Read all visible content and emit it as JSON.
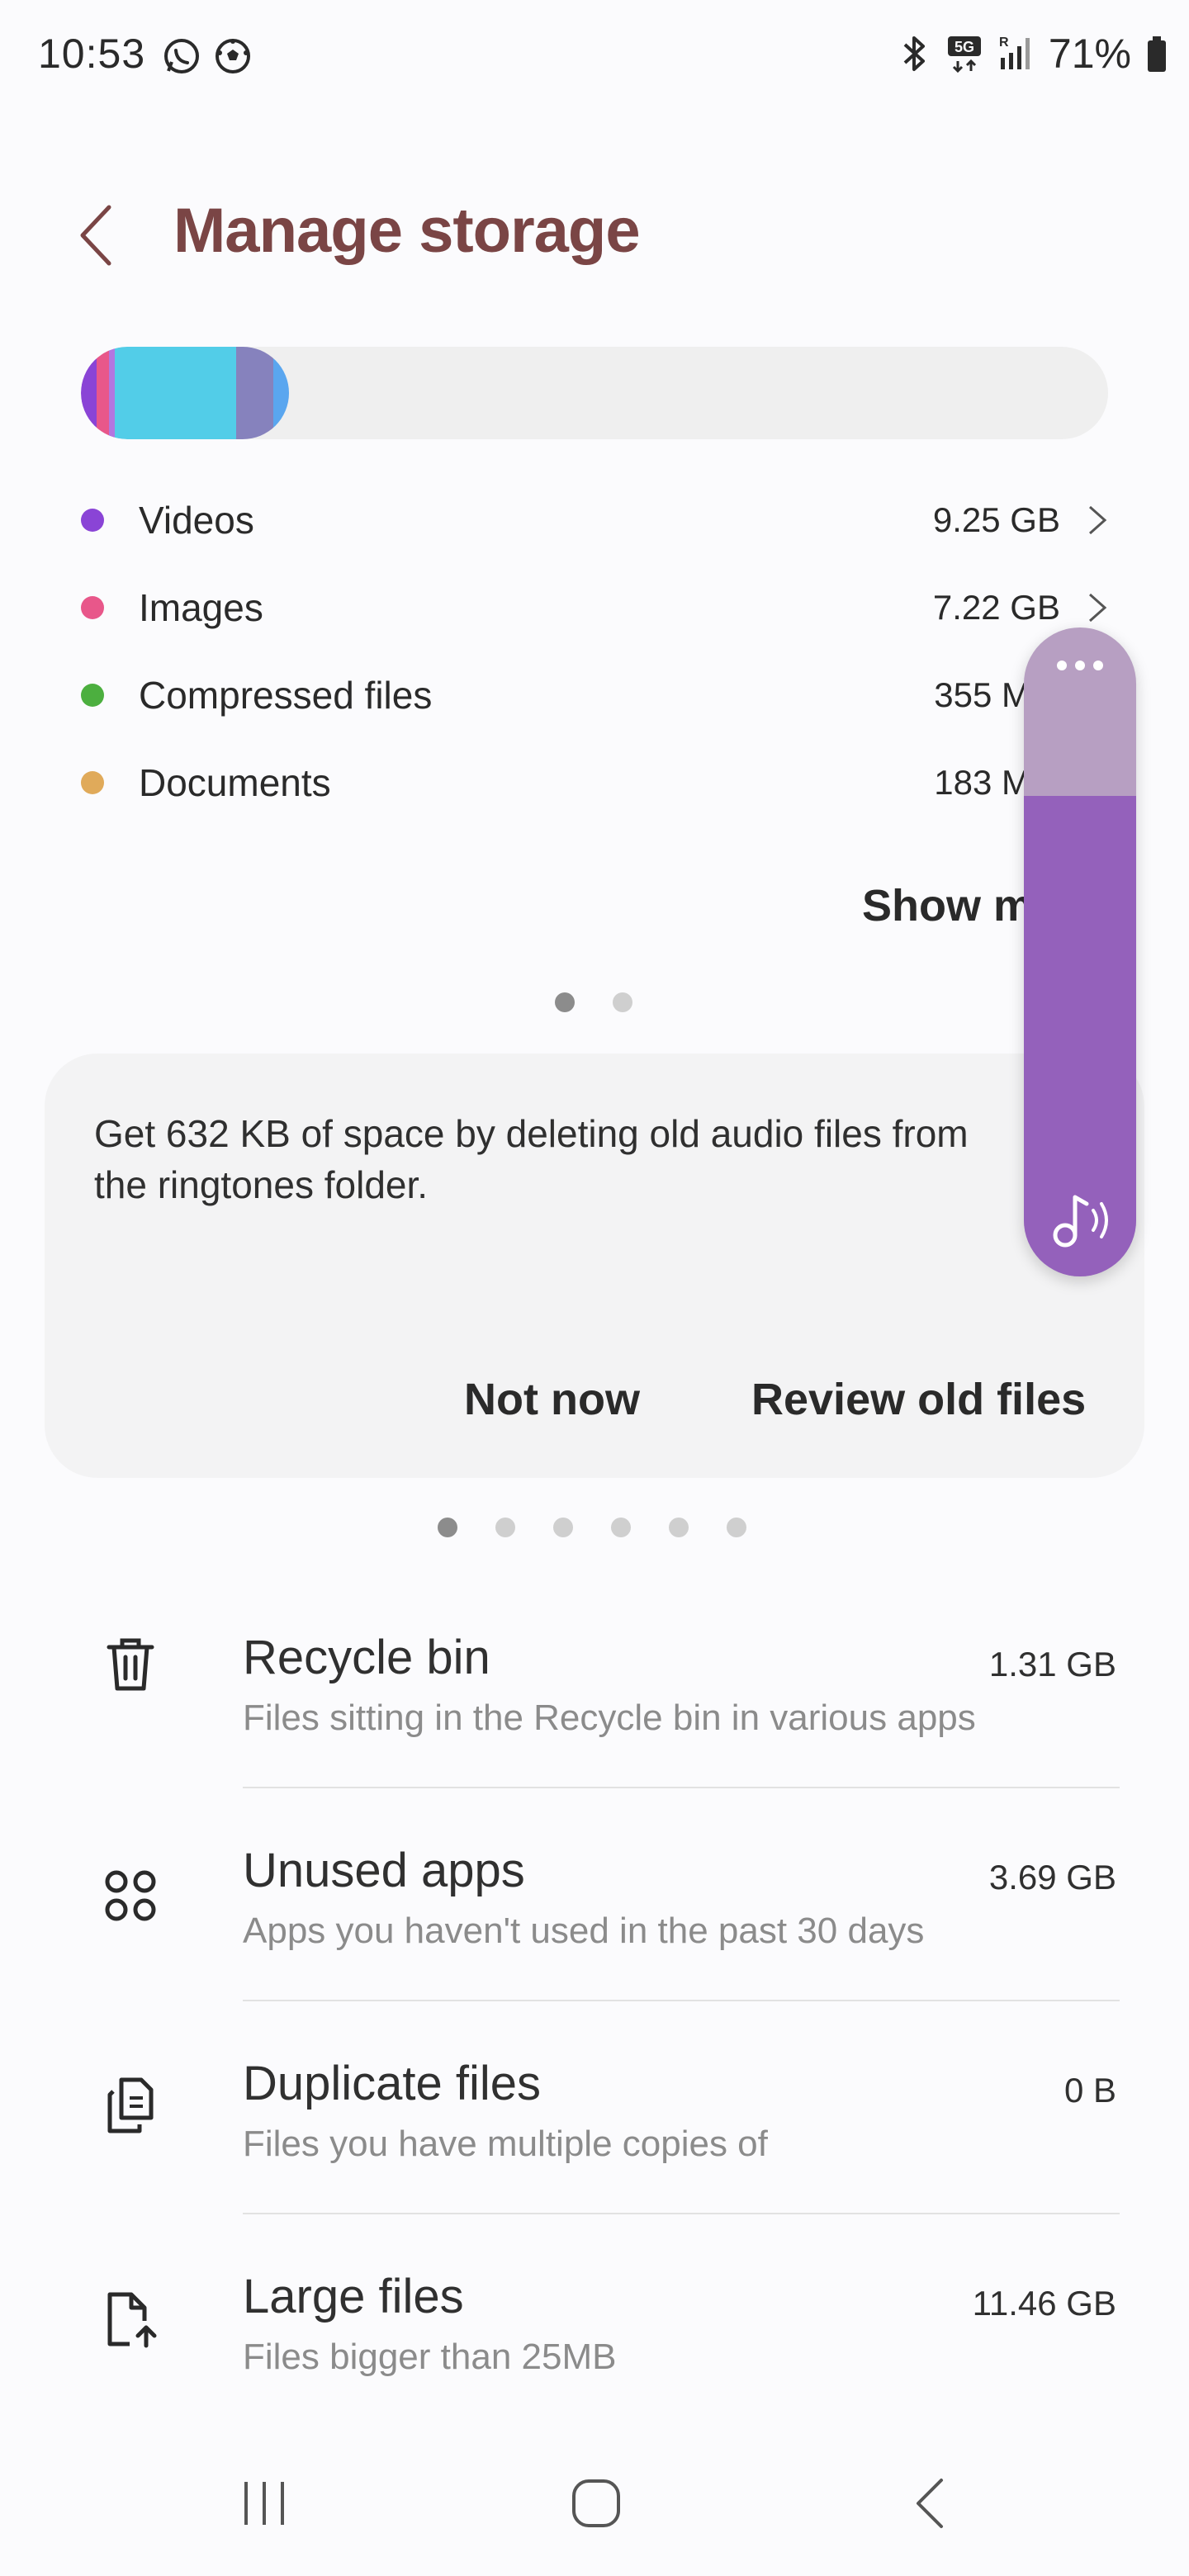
{
  "status_bar": {
    "time": "10:53",
    "battery": "71%",
    "icons": [
      "whatsapp-icon",
      "soccer-ball-icon",
      "bluetooth-icon",
      "5g-icon",
      "signal-icon",
      "battery-icon"
    ]
  },
  "header": {
    "title": "Manage storage",
    "back_icon": "chevron-left-icon"
  },
  "storage_bar": {
    "segments": [
      {
        "name": "videos",
        "color": "#8a44d6",
        "fraction": 0.015
      },
      {
        "name": "images",
        "color": "#e8578a",
        "fraction": 0.012
      },
      {
        "name": "purple-2",
        "color": "#b276e0",
        "fraction": 0.006
      },
      {
        "name": "apps",
        "color": "#52cde8",
        "fraction": 0.118
      },
      {
        "name": "system",
        "color": "#8682bd",
        "fraction": 0.036
      },
      {
        "name": "other",
        "color": "#5aa6ef",
        "fraction": 0.015
      }
    ],
    "track_color": "#efefef"
  },
  "categories": [
    {
      "label": "Videos",
      "size": "9.25 GB",
      "color": "#8a44d6"
    },
    {
      "label": "Images",
      "size": "7.22 GB",
      "color": "#e8578a"
    },
    {
      "label": "Compressed files",
      "size": "355 M",
      "color": "#4caf3f"
    },
    {
      "label": "Documents",
      "size": "183 M",
      "color": "#e0aa5a"
    }
  ],
  "show_more": "Show m",
  "suggestion_card": {
    "text": "Get 632 KB of space by deleting old audio files from the ringtones folder.",
    "btn_not_now": "Not now",
    "btn_review": "Review old files"
  },
  "volume_panel": {
    "level": 0.74,
    "icon": "music-note-icon"
  },
  "tools": [
    {
      "title": "Recycle bin",
      "subtitle": "Files sitting in the Recycle bin in various apps",
      "size": "1.31 GB",
      "icon": "trash-icon"
    },
    {
      "title": "Unused apps",
      "subtitle": "Apps you haven't used in the past 30 days",
      "size": "3.69 GB",
      "icon": "apps-grid-icon"
    },
    {
      "title": "Duplicate files",
      "subtitle": "Files you have multiple copies of",
      "size": "0 B",
      "icon": "duplicate-files-icon"
    },
    {
      "title": "Large files",
      "subtitle": "Files bigger than 25MB",
      "size": "11.46 GB",
      "icon": "large-file-icon"
    }
  ],
  "nav_bar": {
    "items": [
      "recent-apps-icon",
      "home-icon",
      "back-icon"
    ]
  }
}
